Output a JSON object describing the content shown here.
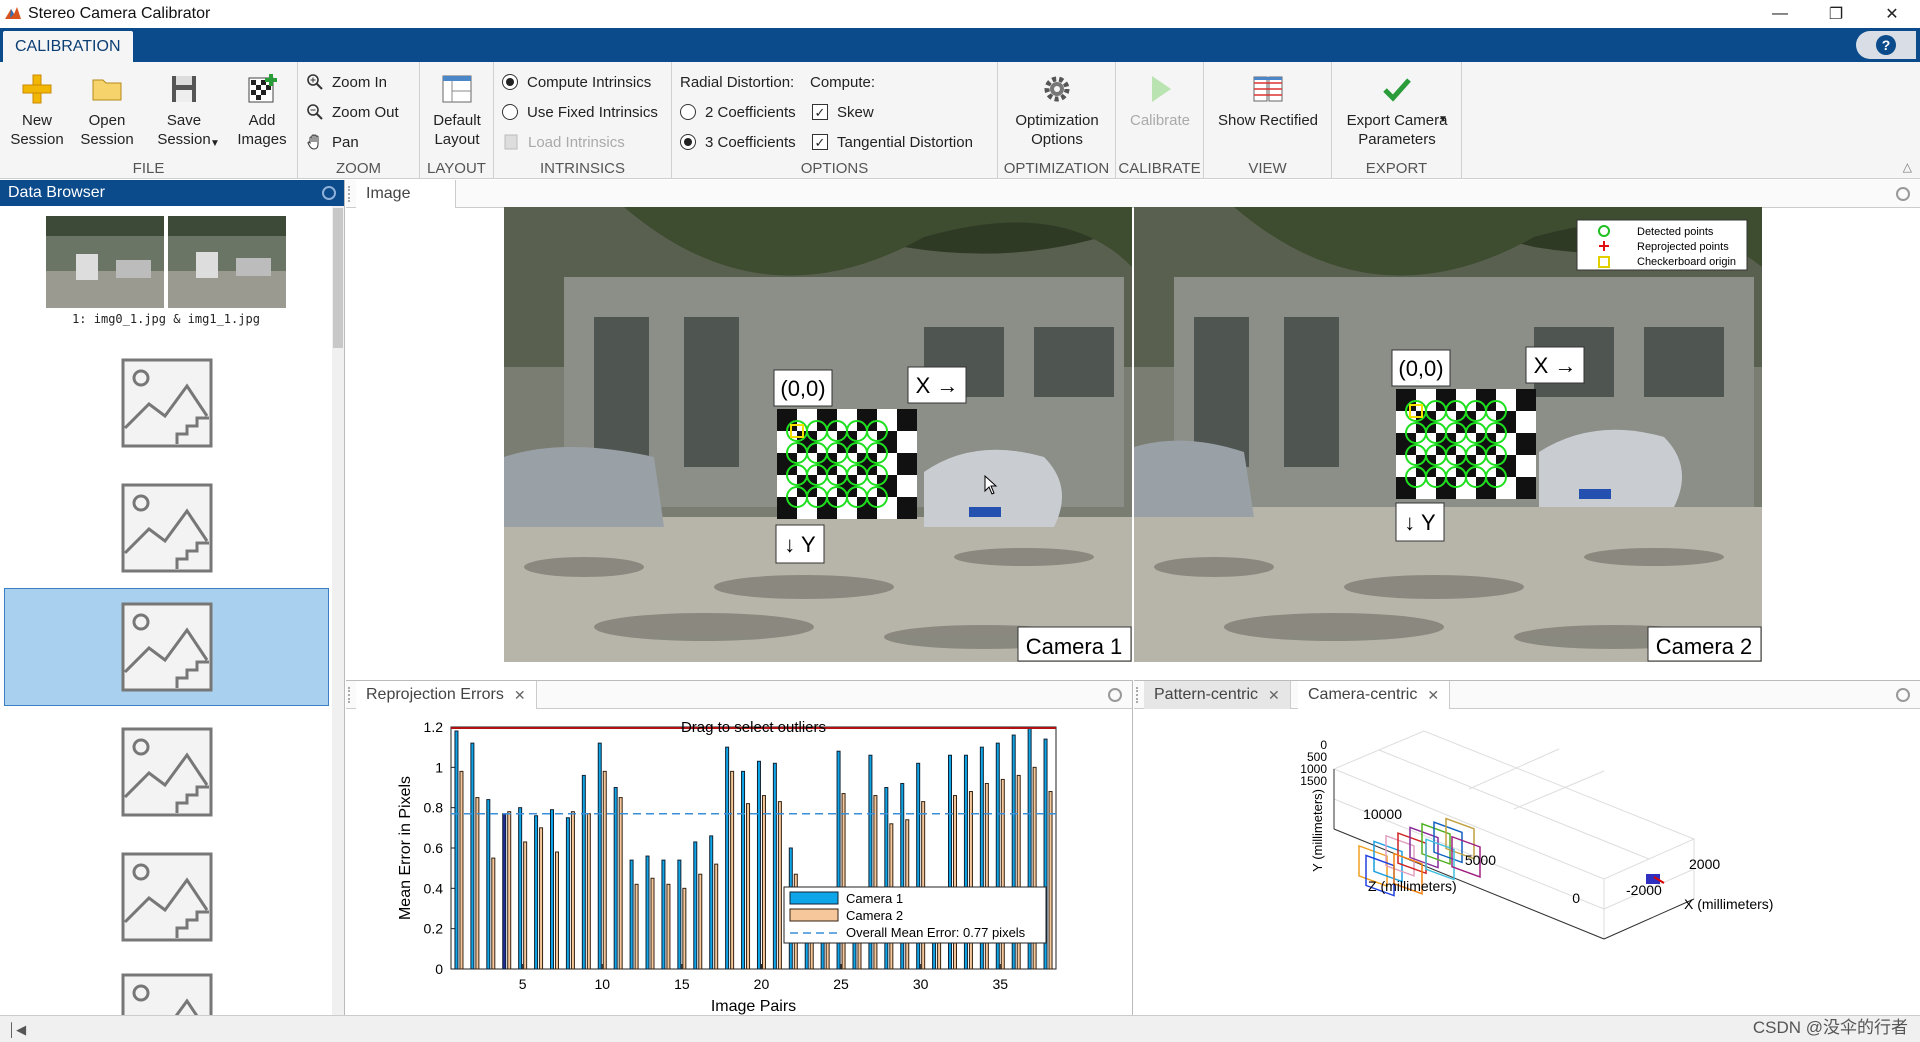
{
  "window": {
    "title": "Stereo Camera Calibrator"
  },
  "ribbon_tab": "CALIBRATION",
  "file": {
    "label": "FILE",
    "new": "New\nSession",
    "open": "Open\nSession",
    "save": "Save\nSession",
    "add": "Add\nImages"
  },
  "zoom": {
    "label": "ZOOM",
    "zoom_in": "Zoom In",
    "zoom_out": "Zoom Out",
    "pan": "Pan"
  },
  "layout": {
    "label": "LAYOUT",
    "default": "Default\nLayout"
  },
  "intrinsics": {
    "label": "INTRINSICS",
    "compute": "Compute Intrinsics",
    "fixed": "Use Fixed Intrinsics",
    "load": "Load Intrinsics"
  },
  "options": {
    "label": "OPTIONS",
    "radial_title": "Radial Distortion:",
    "compute_title": "Compute:",
    "two": "2 Coefficients",
    "three": "3 Coefficients",
    "skew": "Skew",
    "tangential": "Tangential Distortion"
  },
  "optimization": {
    "label": "OPTIMIZATION",
    "btn": "Optimization\nOptions"
  },
  "calibrate": {
    "label": "CALIBRATE",
    "btn": "Calibrate"
  },
  "view": {
    "label": "VIEW",
    "btn": "Show Rectified"
  },
  "export": {
    "label": "EXPORT",
    "btn": "Export Camera\nParameters"
  },
  "data_browser": {
    "title": "Data Browser",
    "first_caption": "1:  img0_1.jpg & img1_1.jpg"
  },
  "image_panel": {
    "tab": "Image",
    "camera1": "Camera 1",
    "camera2": "Camera 2",
    "origin": "(0,0)",
    "x_axis": "X →",
    "y_axis": "↓ Y",
    "legend": [
      "Detected points",
      "Reprojected points",
      "Checkerboard origin"
    ]
  },
  "reproj_panel": {
    "tab": "Reprojection Errors",
    "x_label": "Image Pairs",
    "y_label": "Mean Error in Pixels",
    "hint": "Drag to select outliers"
  },
  "chart_data": {
    "type": "bar",
    "title": "",
    "xlabel": "Image Pairs",
    "ylabel": "Mean Error in Pixels",
    "ylim": [
      0,
      1.2
    ],
    "xlim": [
      0.5,
      38.5
    ],
    "x_ticks": [
      5,
      10,
      15,
      20,
      25,
      30,
      35
    ],
    "y_ticks": [
      0,
      0.2,
      0.4,
      0.6,
      0.8,
      1,
      1.2
    ],
    "categories": [
      1,
      2,
      3,
      4,
      5,
      6,
      7,
      8,
      9,
      10,
      11,
      12,
      13,
      14,
      15,
      16,
      17,
      18,
      19,
      20,
      21,
      22,
      23,
      24,
      25,
      26,
      27,
      28,
      29,
      30,
      31,
      32,
      33,
      34,
      35,
      36,
      37,
      38
    ],
    "series": [
      {
        "name": "Camera 1",
        "color": "#0ea5e9",
        "values": [
          1.18,
          1.12,
          0.84,
          0.77,
          0.8,
          0.76,
          0.79,
          0.75,
          0.96,
          1.12,
          0.9,
          0.54,
          0.56,
          0.54,
          0.54,
          0.63,
          0.66,
          1.1,
          0.98,
          1.03,
          1.02,
          0.6,
          0.38,
          0.38,
          1.08,
          0.38,
          1.06,
          0.9,
          0.92,
          1.02,
          0.34,
          1.06,
          1.06,
          1.1,
          1.12,
          1.16,
          1.2,
          1.14
        ]
      },
      {
        "name": "Camera 2",
        "color": "#f5c79a",
        "values": [
          0.98,
          0.85,
          0.55,
          0.78,
          0.63,
          0.7,
          0.58,
          0.78,
          0.77,
          0.98,
          0.85,
          0.42,
          0.45,
          0.42,
          0.4,
          0.47,
          0.52,
          0.98,
          0.82,
          0.86,
          0.83,
          0.47,
          0.28,
          0.28,
          0.87,
          0.26,
          0.86,
          0.72,
          0.74,
          0.83,
          0.24,
          0.86,
          0.88,
          0.92,
          0.94,
          0.96,
          1.0,
          0.88
        ]
      }
    ],
    "highlighted": [
      4
    ],
    "overall_mean": 0.77,
    "legend": [
      "Camera 1",
      "Camera 2",
      "Overall Mean Error: 0.77 pixels"
    ]
  },
  "extrinsics_panel": {
    "tab1": "Pattern-centric",
    "tab2": "Camera-centric",
    "y_label": "Y (millimeters)",
    "z_label": "Z (millimeters)",
    "x_label": "X (millimeters)",
    "z_ticks": [
      "10000",
      "5000",
      "0"
    ],
    "x_ticks": [
      "2000",
      "-2000"
    ],
    "y_ticks": [
      "0",
      "500",
      "1000",
      "1500"
    ]
  },
  "watermark": "CSDN @没伞的行者"
}
